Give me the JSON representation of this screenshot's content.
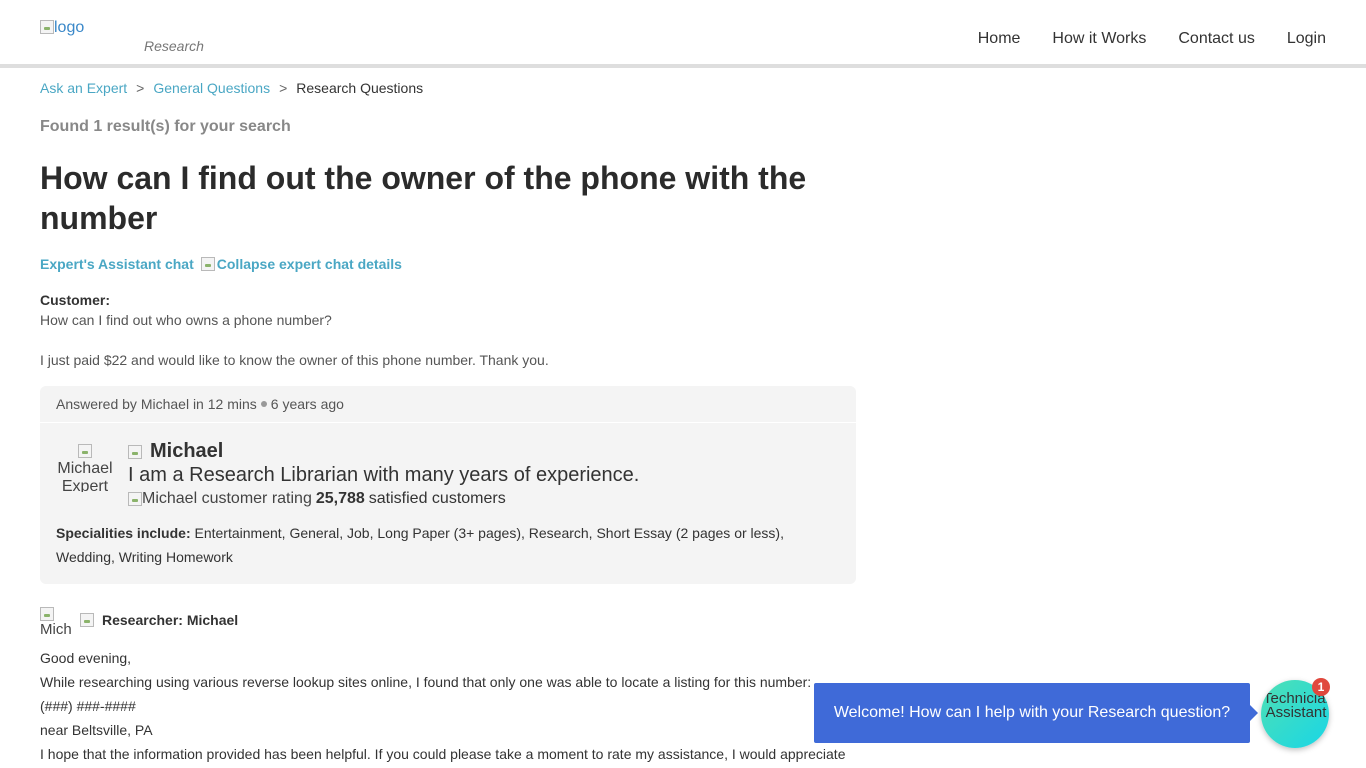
{
  "header": {
    "logo_alt": "logo",
    "logo_subtitle": "Research",
    "nav": [
      "Home",
      "How it Works",
      "Contact us",
      "Login"
    ]
  },
  "breadcrumb": {
    "items": [
      "Ask an Expert",
      "General Questions"
    ],
    "current": "Research Questions",
    "separator": ">"
  },
  "search": {
    "found_text": "Found 1 result(s) for your search"
  },
  "question": {
    "title": "How can I find out the owner of the phone with the number",
    "chat_link": "Expert's Assistant chat",
    "collapse_alt": "Collapse expert chat details",
    "customer_label": "Customer:",
    "customer_question": "How can I find out who owns a phone number?",
    "customer_note": "I just paid $22 and would like to know the owner of this phone number. Thank you."
  },
  "answer_card": {
    "answered_by": "Answered by Michael in 12 mins",
    "time_ago": "6 years ago",
    "avatar_alt": "Michael Expert",
    "expert_name": "Michael",
    "expert_description": "I am a Research Librarian with many years of experience.",
    "rating_alt": "Michael customer rating",
    "satisfied_count": "25,788",
    "satisfied_suffix": "satisfied customers",
    "specialities_label": "Specialities include:",
    "specialities": "Entertainment, General, Job, Long Paper (3+ pages), Research, Short Essay (2 pages or less), Wedding, Writing Homework"
  },
  "response": {
    "avatar_alt": "Michael",
    "author": "Researcher: Michael",
    "lines": [
      "Good evening,",
      "While researching using various reverse lookup sites online, I found that only one was able to locate a listing for this number:",
      "(###) ###-####",
      "near Beltsville, PA",
      "I hope that the information provided has been helpful. If you could please take a moment to rate my assistance, I would appreciate"
    ]
  },
  "chat_widget": {
    "message": "Welcome! How can I help with your Research question?",
    "launcher_alt": "Technician Assistant",
    "badge_count": "1"
  },
  "colors": {
    "link": "#4aa7c4",
    "bubble": "#3f6ad8",
    "badge": "#e0483d",
    "card_bg": "#f4f4f4"
  }
}
